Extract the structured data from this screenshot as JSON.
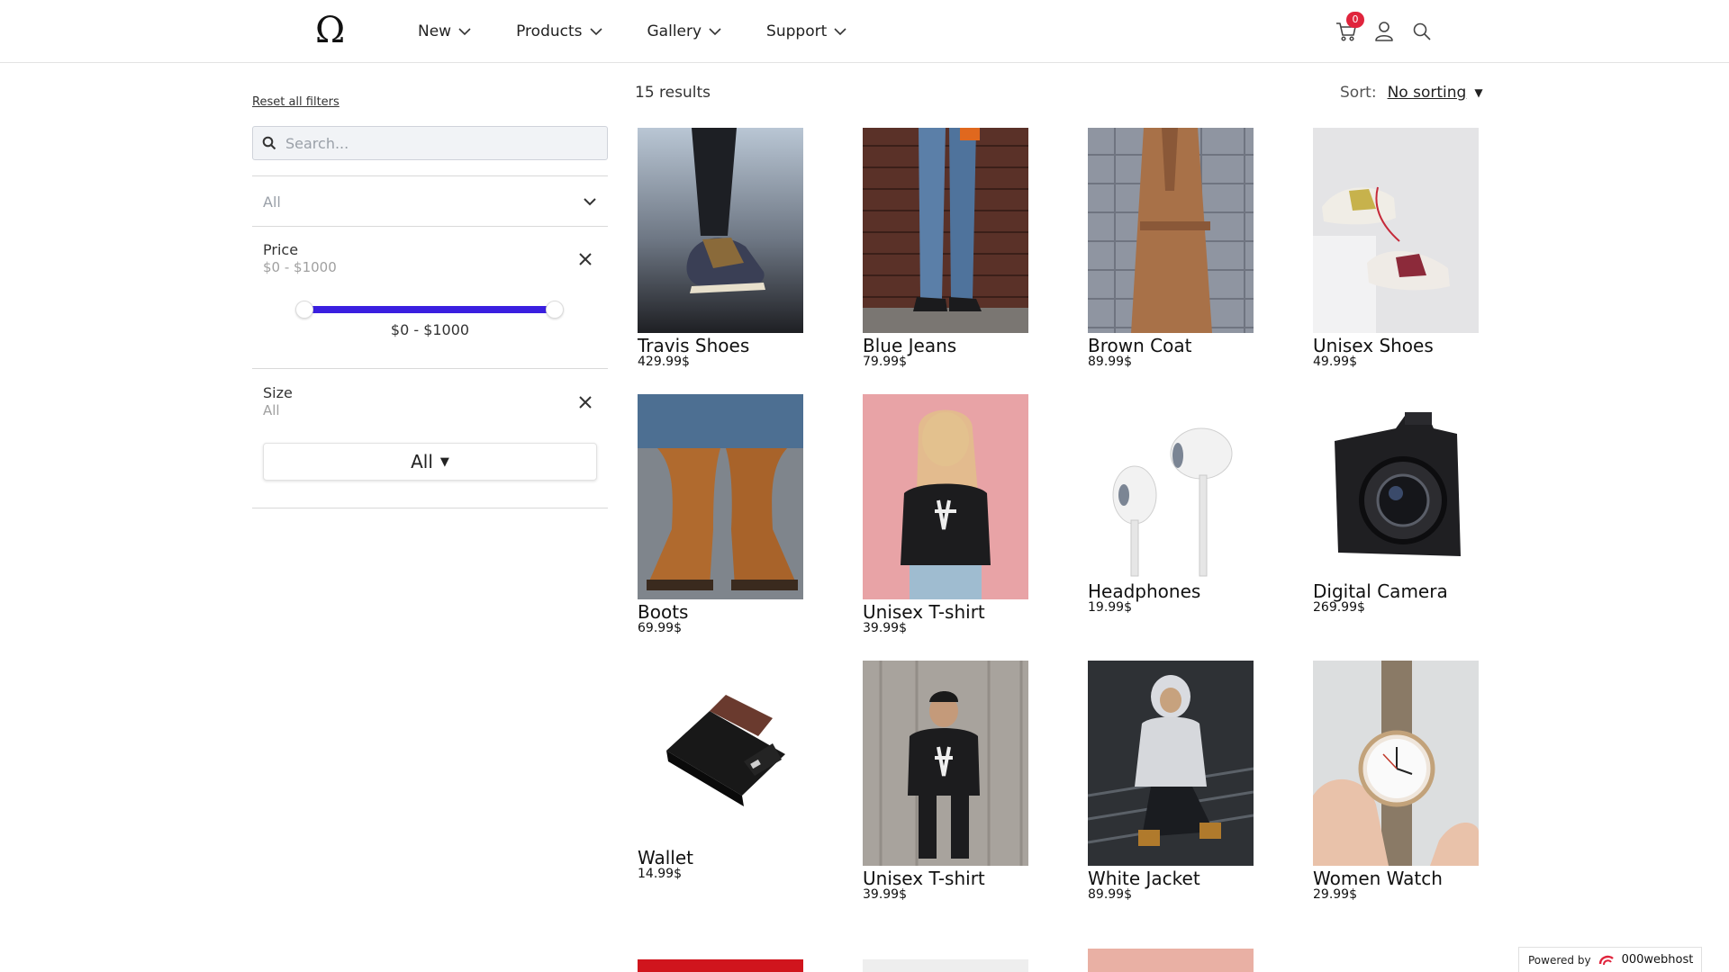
{
  "header": {
    "logo": "Ω",
    "nav": [
      "New",
      "Products",
      "Gallery",
      "Support"
    ],
    "cart_count": "0"
  },
  "filters": {
    "reset_label": "Reset all filters",
    "search_placeholder": "Search...",
    "category_value": "All",
    "price": {
      "title": "Price",
      "subtitle": "$0 - $1000",
      "range_label": "$0 - $1000",
      "min": 0,
      "max": 1000
    },
    "size": {
      "title": "Size",
      "subtitle": "All",
      "select_value": "All"
    },
    "accent_color": "#3a1fe0"
  },
  "results": {
    "count_label": "15 results",
    "sort_label": "Sort:",
    "sort_value": "No sorting"
  },
  "products": [
    {
      "name": "Travis Shoes",
      "price": "429.99$"
    },
    {
      "name": "Blue Jeans",
      "price": "79.99$"
    },
    {
      "name": "Brown Coat",
      "price": "89.99$"
    },
    {
      "name": "Unisex Shoes",
      "price": "49.99$"
    },
    {
      "name": "Boots",
      "price": "69.99$"
    },
    {
      "name": "Unisex T-shirt",
      "price": "39.99$"
    },
    {
      "name": "Headphones",
      "price": "19.99$"
    },
    {
      "name": "Digital Camera",
      "price": "269.99$"
    },
    {
      "name": "Wallet",
      "price": "14.99$"
    },
    {
      "name": "Unisex T-shirt",
      "price": "39.99$"
    },
    {
      "name": "White Jacket",
      "price": "89.99$"
    },
    {
      "name": "Women Watch",
      "price": "29.99$"
    }
  ],
  "footer": {
    "powered_by": "Powered by",
    "brand": "000webhost"
  }
}
